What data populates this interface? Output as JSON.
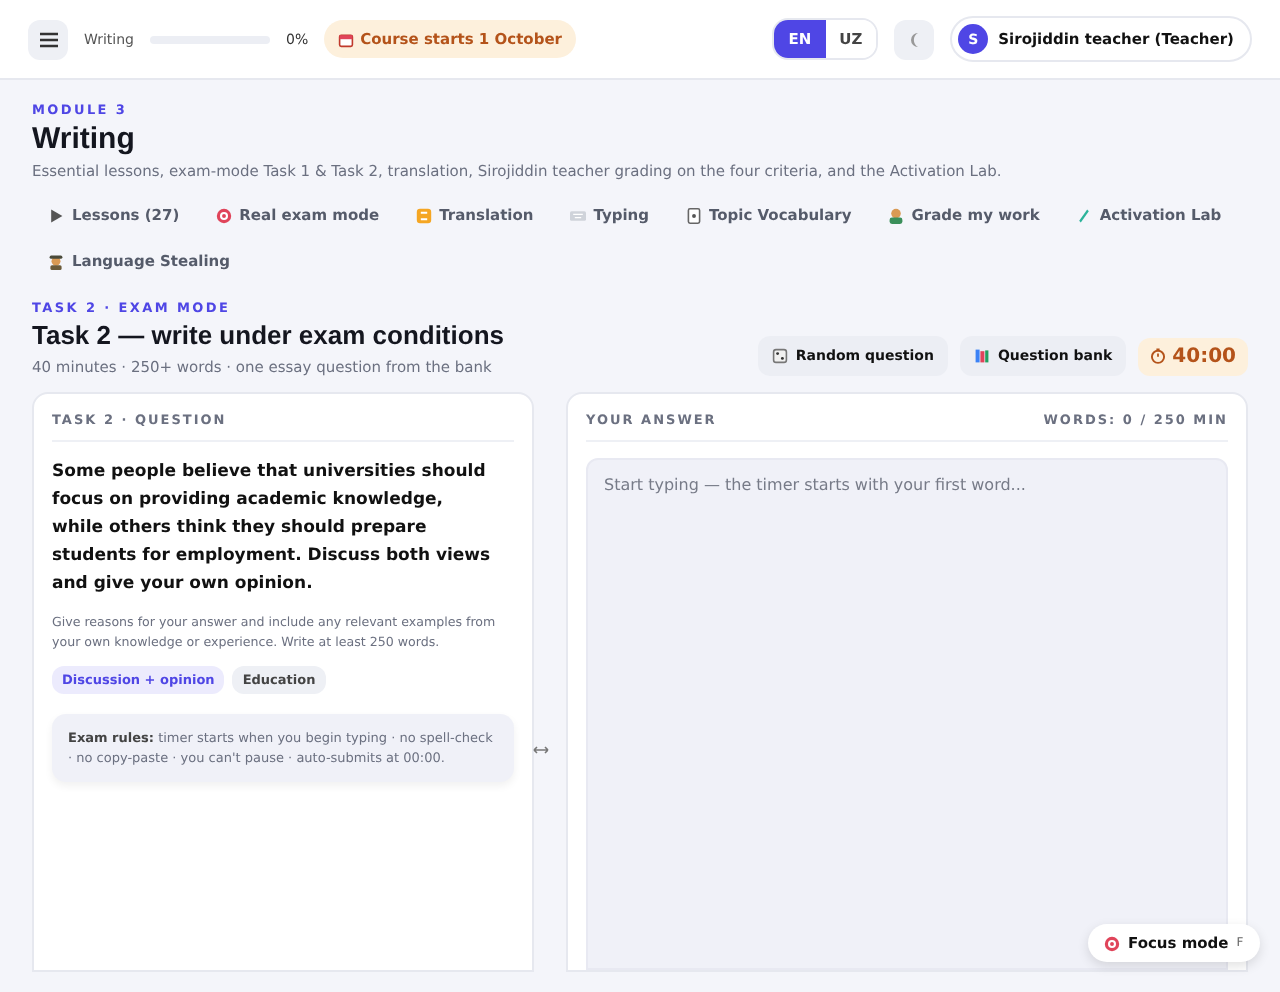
{
  "header": {
    "menu_label": "Writing",
    "progress": {
      "level": 0,
      "reading": "0%"
    },
    "course_badge": "Course starts 1 October",
    "languages": [
      {
        "label": "EN",
        "selected": true
      },
      {
        "label": "UZ",
        "selected": false
      }
    ],
    "user": {
      "initial": "S",
      "name": "Sirojiddin teacher (Teacher)"
    }
  },
  "module": {
    "eyebrow": "MODULE 3",
    "title": "Writing",
    "description": "Essential lessons, exam-mode Task 1 & Task 2, translation, Sirojiddin teacher grading on the four criteria, and the Activation Lab."
  },
  "tabs": [
    {
      "label": "Lessons (27)"
    },
    {
      "label": "Real exam mode"
    },
    {
      "label": "Translation"
    },
    {
      "label": "Typing"
    },
    {
      "label": "Topic Vocabulary"
    },
    {
      "label": "Grade my work"
    },
    {
      "label": "Activation Lab"
    },
    {
      "label": "Language Stealing"
    }
  ],
  "task": {
    "eyebrow": "TASK 2 · EXAM MODE",
    "title": "Task 2 — write under exam conditions",
    "subtitle": "40 minutes · 250+ words · one essay question from the bank",
    "buttons": [
      {
        "label": "Random question"
      },
      {
        "label": "Question bank"
      }
    ],
    "timer": "40:00"
  },
  "question_panel": {
    "heading": "TASK 2 · QUESTION",
    "question": "Some people believe that universities should focus on providing academic knowledge, while others think they should prepare students for employment. Discuss both views and give your own opinion.",
    "instructions": "Give reasons for your answer and include any relevant examples from your own knowledge or experience. Write at least 250 words.",
    "tags": [
      {
        "label": "Discussion + opinion",
        "color": "#ecebfd"
      },
      {
        "label": "Education",
        "color": "#eef0f5"
      }
    ],
    "rules": "**Exam rules:** timer starts when you begin typing · no spell-check · no copy-paste · you can't pause · auto-submits at 00:00."
  },
  "answer_panel": {
    "heading": "YOUR ANSWER",
    "word_count": "WORDS: 0 / 250 MIN",
    "placeholder": "Start typing — the timer starts with your first word..."
  },
  "focus_button": {
    "label": "Focus mode",
    "shortcut": "F"
  }
}
